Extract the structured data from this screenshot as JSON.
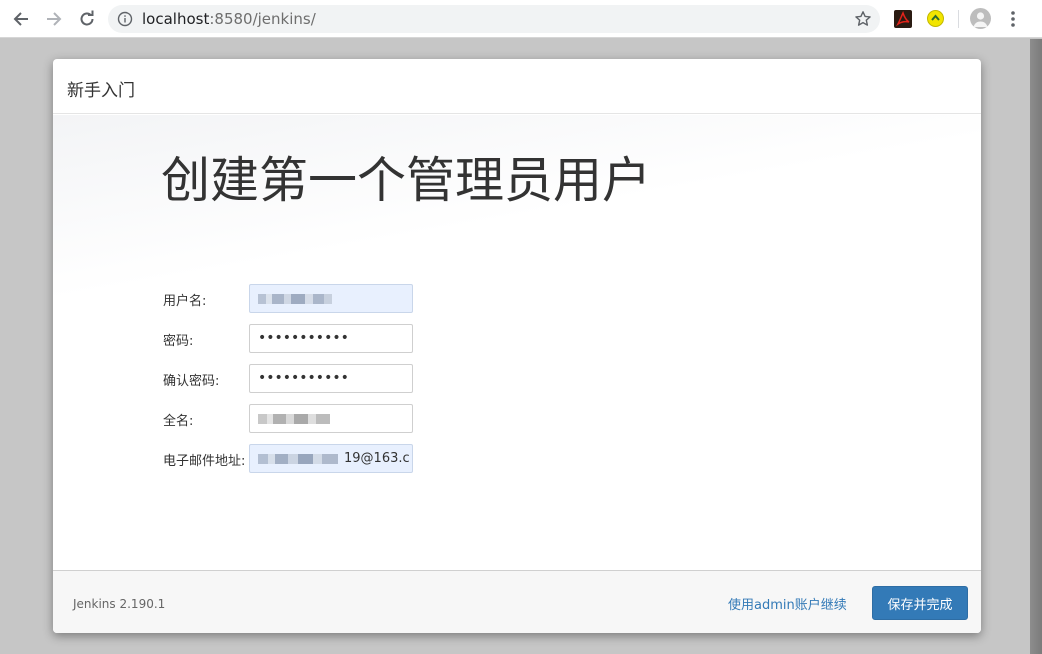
{
  "browser": {
    "url_host": "localhost",
    "url_rest": ":8580/jenkins/"
  },
  "dialog": {
    "header_title": "新手入门",
    "page_title": "创建第一个管理员用户",
    "fields": {
      "username": {
        "label": "用户名:"
      },
      "password": {
        "label": "密码:",
        "value": "•••••••••••"
      },
      "confirm_password": {
        "label": "确认密码:",
        "value": "•••••••••••"
      },
      "fullname": {
        "label": "全名:"
      },
      "email": {
        "label": "电子邮件地址:",
        "value_suffix": "19@163.c"
      }
    },
    "footer": {
      "version": "Jenkins 2.190.1",
      "continue_link": "使用admin账户继续",
      "save_button": "保存并完成"
    }
  },
  "colors": {
    "primary": "#337ab7",
    "autofill": "#e8f0fe"
  }
}
